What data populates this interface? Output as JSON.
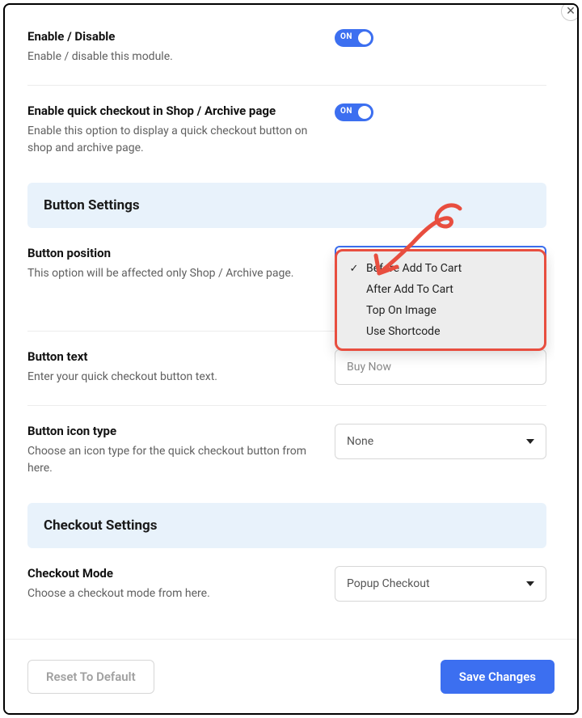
{
  "toggle_on_label": "ON",
  "rows": {
    "enable": {
      "title": "Enable / Disable",
      "desc": "Enable / disable this module."
    },
    "enable_archive": {
      "title": "Enable quick checkout in Shop / Archive page",
      "desc": "Enable this option to display a quick checkout button on shop and archive page."
    },
    "button_position": {
      "title": "Button position",
      "desc": "This option will be affected only Shop / Archive page.",
      "options": [
        "Before Add To Cart",
        "After Add To Cart",
        "Top On Image",
        "Use Shortcode"
      ],
      "selected_index": 0
    },
    "button_text": {
      "title": "Button text",
      "desc": "Enter your quick checkout button text.",
      "value": "Buy Now"
    },
    "button_icon_type": {
      "title": "Button icon type",
      "desc": "Choose an icon type for the quick checkout button from here.",
      "value": "None"
    },
    "checkout_mode": {
      "title": "Checkout Mode",
      "desc": "Choose a checkout mode from here.",
      "value": "Popup Checkout"
    }
  },
  "sections": {
    "button_settings": "Button Settings",
    "checkout_settings": "Checkout Settings"
  },
  "footer": {
    "reset": "Reset To Default",
    "save": "Save Changes"
  },
  "close_glyph": "✕",
  "check_glyph": "✓"
}
